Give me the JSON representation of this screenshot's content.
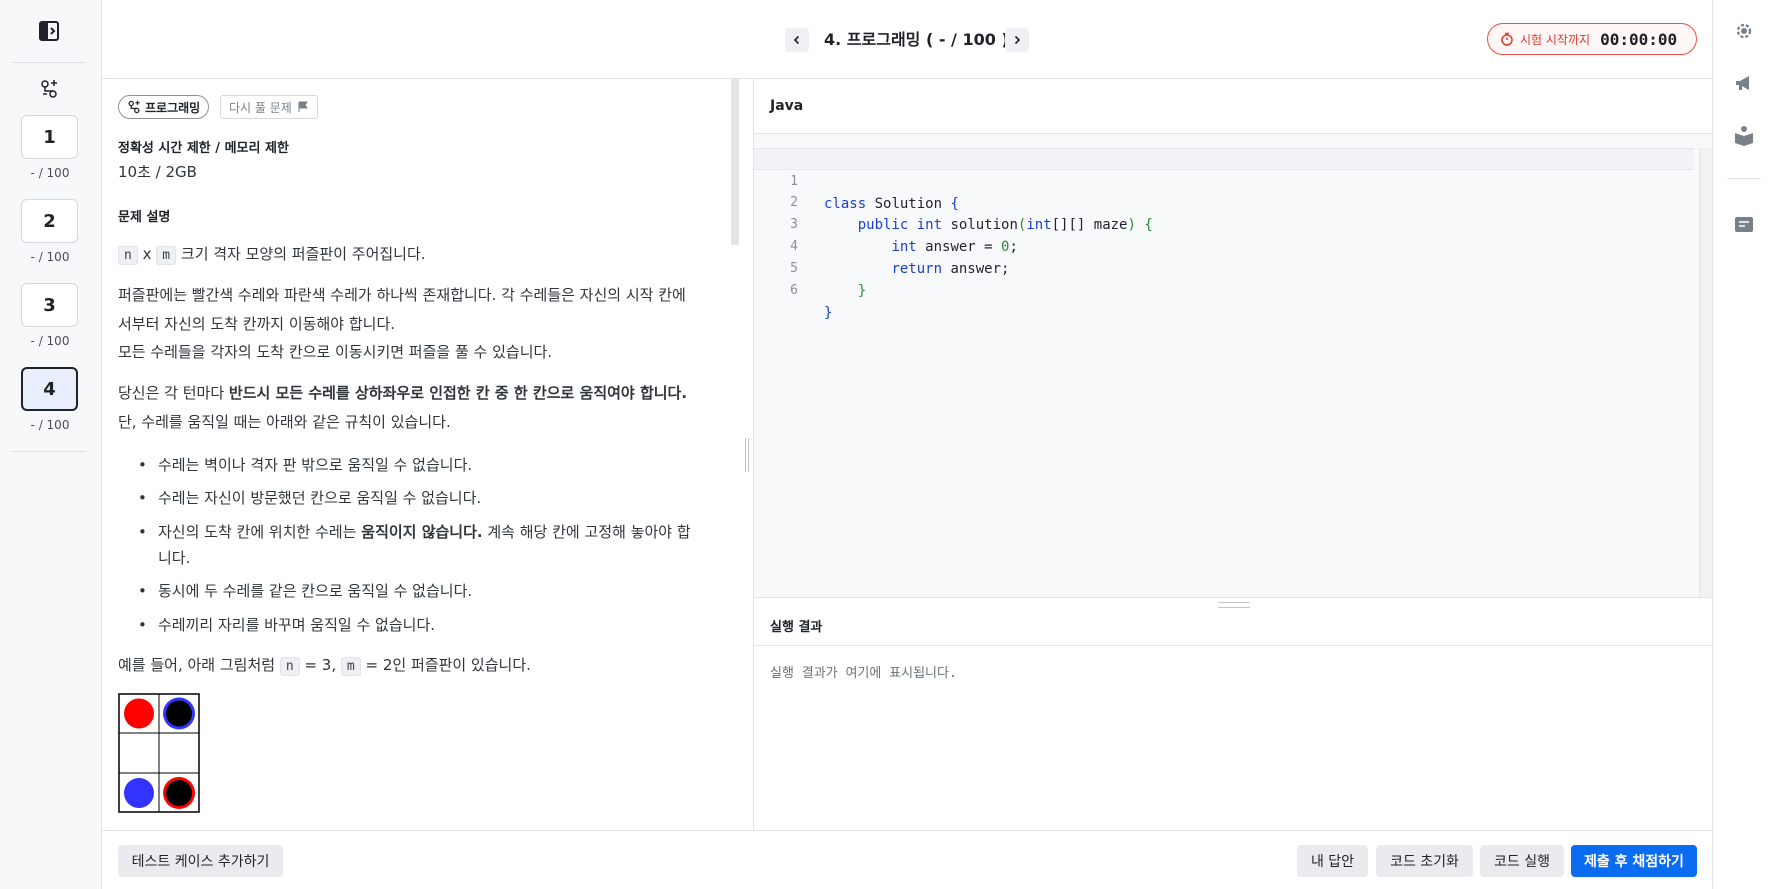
{
  "sidebar": {
    "questions": [
      {
        "number": "1",
        "score": "- / 100"
      },
      {
        "number": "2",
        "score": "- / 100"
      },
      {
        "number": "3",
        "score": "- / 100"
      },
      {
        "number": "4",
        "score": "- / 100"
      }
    ]
  },
  "header": {
    "title": "4. 프로그래밍 ( - / 100 )",
    "timer_label": "시험 시작까지",
    "timer_value": "00:00:00"
  },
  "problem": {
    "type_tag": "프로그래밍",
    "retry_tag": "다시 풀 문제",
    "limits_heading": "정확성 시간 제한 / 메모리 제한",
    "limits_value": "10초 / 2GB",
    "description_heading": "문제 설명",
    "var_n": "n",
    "var_m": "m",
    "p1_x": "x",
    "p1_rest": "크기 격자 모양의 퍼즐판이 주어집니다.",
    "p2_line1": "퍼즐판에는 빨간색 수레와 파란색 수레가 하나씩 존재합니다. 각 수레들은 자신의 시작 칸에",
    "p2_line2": "서부터 자신의 도착 칸까지 이동해야 합니다.",
    "p2_line3": "모든 수레들을 각자의 도착 칸으로 이동시키면 퍼즐을 풀 수 있습니다.",
    "p3_prefix": "당신은 각 턴마다",
    "p3_bold": "반드시 모든 수레를 상하좌우로 인접한 칸 중 한 칸으로 움직여야 합니다.",
    "p3_line2": "단, 수레를 움직일 때는 아래와 같은 규칙이 있습니다.",
    "rules": {
      "r1": "수레는 벽이나 격자 판 밖으로 움직일 수 없습니다.",
      "r2": "수레는 자신이 방문했던 칸으로 움직일 수 없습니다.",
      "r3_prefix": "자신의 도착 칸에 위치한 수레는",
      "r3_bold": "움직이지 않습니다.",
      "r3_suffix": "계속 해당 칸에 고정해 놓아야 합",
      "r3_line2": "니다.",
      "r4": "동시에 두 수레를 같은 칸으로 움직일 수 없습니다.",
      "r5": "수레끼리 자리를 바꾸며 움직일 수 없습니다."
    },
    "example_prefix": "예를 들어, 아래 그림처럼",
    "example_eq1": "= 3,",
    "example_eq2": "= 2인 퍼즐판이 있습니다."
  },
  "editor": {
    "language": "Java",
    "lines": {
      "l1": {
        "no": "1",
        "a": "class",
        "b": " Solution ",
        "c": "{"
      },
      "l2": {
        "no": "2",
        "a": "public",
        "b": "int",
        "c": " solution",
        "d": "(",
        "e": "int",
        "f": "[][]",
        "g": " maze",
        "h": ")",
        "i": " {"
      },
      "l3": {
        "no": "3",
        "a": "int",
        "b": " answer = ",
        "c": "0",
        "d": ";"
      },
      "l4": {
        "no": "4",
        "a": "return",
        "b": " answer;"
      },
      "l5": {
        "no": "5",
        "a": "}"
      },
      "l6": {
        "no": "6",
        "a": "}"
      }
    }
  },
  "results": {
    "title": "실행 결과",
    "placeholder": "실행 결과가 여기에 표시됩니다."
  },
  "footer": {
    "add_testcase": "테스트 케이스 추가하기",
    "my_answer": "내 답안",
    "reset_code": "코드 초기화",
    "run_code": "코드 실행",
    "submit": "제출 후 채점하기"
  },
  "colors": {
    "accent": "#0b6cf2",
    "timer_red": "#e03a33",
    "red_cart": "#ff0000",
    "blue_cart": "#3333ff"
  },
  "icons": {
    "sidebar_toggle": "sidebar-collapse-icon",
    "type": "programming-icon",
    "settings": "gear-icon",
    "announce": "megaphone-icon",
    "book": "book-icon",
    "memo": "memo-icon",
    "timer": "stopwatch-icon",
    "flag": "flag-icon"
  }
}
